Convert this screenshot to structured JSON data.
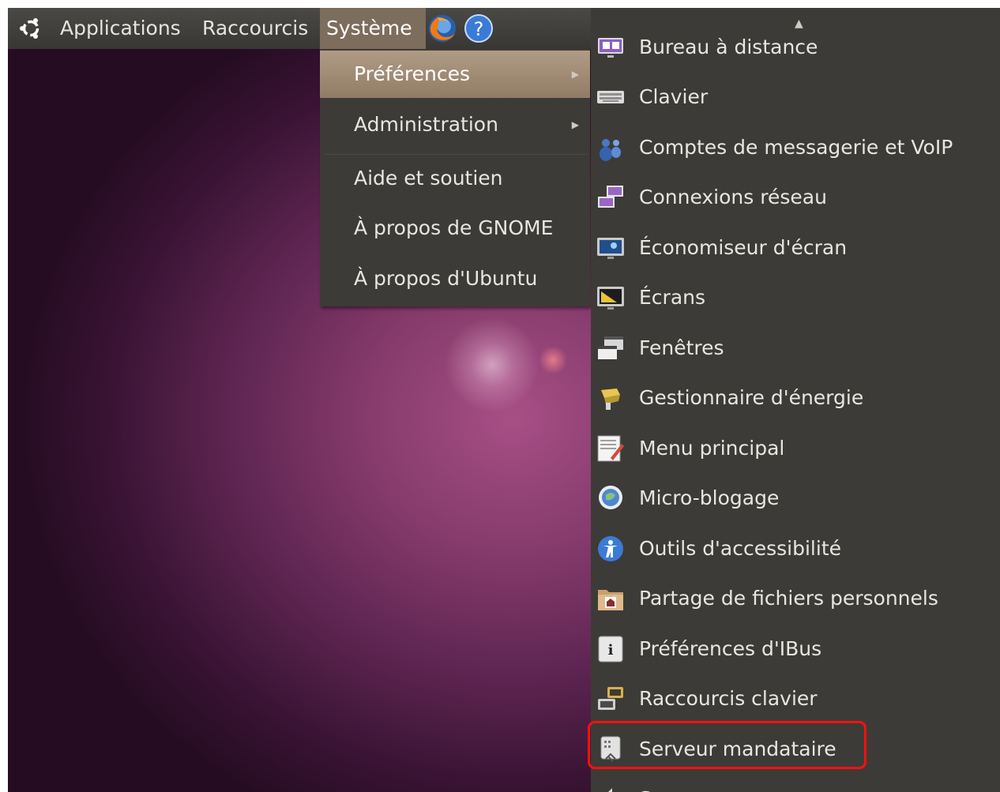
{
  "top_panel": {
    "applications": "Applications",
    "raccourcis": "Raccourcis",
    "systeme": "Système",
    "launchers": [
      "firefox-icon",
      "help-icon"
    ]
  },
  "system_menu": {
    "items": [
      {
        "label": "Préférences",
        "has_submenu": true,
        "active": true
      },
      {
        "label": "Administration",
        "has_submenu": true,
        "active": false
      },
      {
        "label": "Aide et soutien",
        "has_submenu": false,
        "active": false
      },
      {
        "label": "À propos de GNOME",
        "has_submenu": false,
        "active": false
      },
      {
        "label": "À propos d'Ubuntu",
        "has_submenu": false,
        "active": false
      }
    ]
  },
  "preferences_menu": {
    "items": [
      {
        "label": "Bureau à distance",
        "icon": "remote-desktop-icon"
      },
      {
        "label": "Clavier",
        "icon": "keyboard-icon"
      },
      {
        "label": "Comptes de messagerie et VoIP",
        "icon": "messaging-accounts-icon"
      },
      {
        "label": "Connexions réseau",
        "icon": "network-connections-icon"
      },
      {
        "label": "Économiseur d'écran",
        "icon": "screensaver-icon"
      },
      {
        "label": "Écrans",
        "icon": "displays-icon"
      },
      {
        "label": "Fenêtres",
        "icon": "windows-icon"
      },
      {
        "label": "Gestionnaire d'énergie",
        "icon": "power-manager-icon"
      },
      {
        "label": "Menu principal",
        "icon": "main-menu-icon"
      },
      {
        "label": "Micro-blogage",
        "icon": "microblogging-icon"
      },
      {
        "label": "Outils d'accessibilité",
        "icon": "accessibility-icon"
      },
      {
        "label": "Partage de fichiers personnels",
        "icon": "file-sharing-icon"
      },
      {
        "label": "Préférences d'IBus",
        "icon": "ibus-icon"
      },
      {
        "label": "Raccourcis clavier",
        "icon": "keyboard-shortcuts-icon"
      },
      {
        "label": "Serveur mandataire",
        "icon": "proxy-icon",
        "highlighted": true
      },
      {
        "label": "Son",
        "icon": "sound-icon"
      }
    ]
  },
  "colors": {
    "panel": "#3d3b37",
    "menu_highlight": "#9f8a73",
    "annotation": "#ff1010"
  }
}
